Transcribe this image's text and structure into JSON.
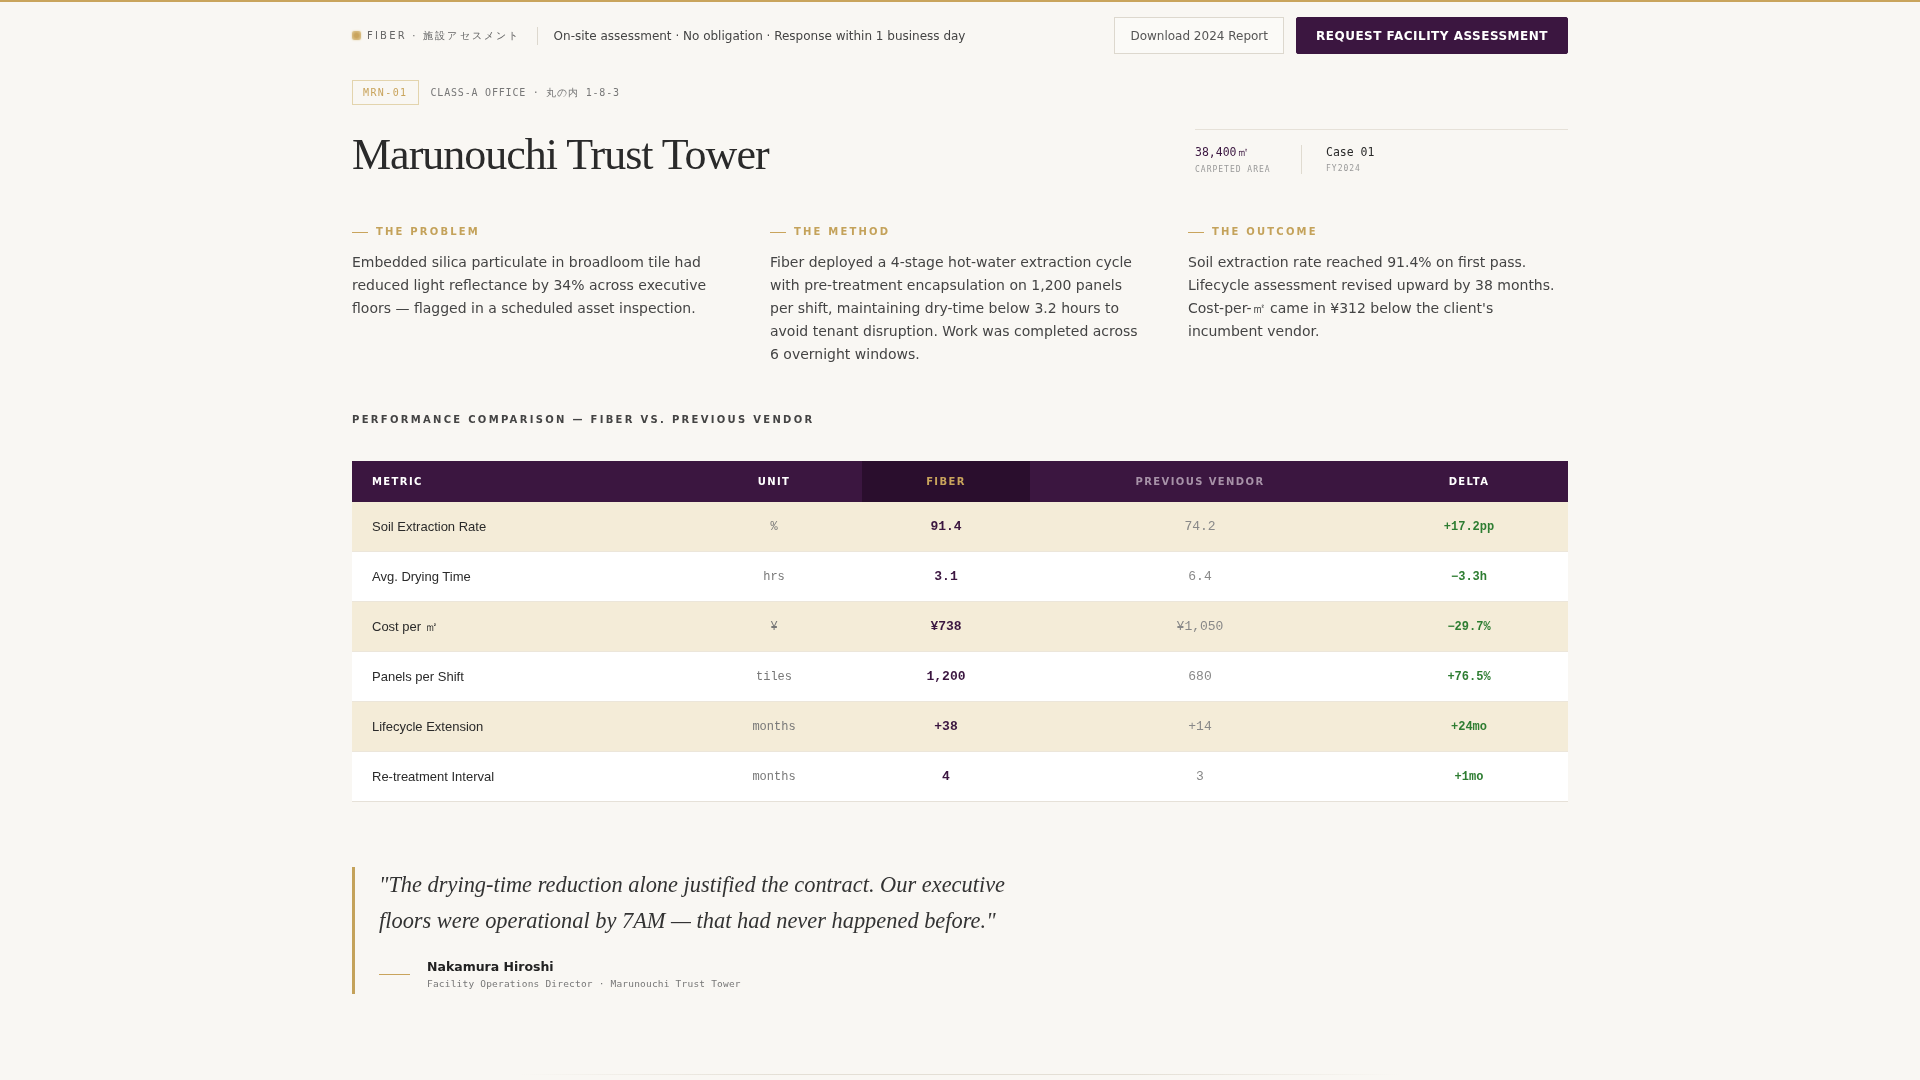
{
  "header": {
    "brand": "FIBER · 施設アセスメント",
    "tagline": "On-site assessment · No obligation · Response within 1 business day",
    "buttons": [
      {
        "label": "Download 2024 Report",
        "kind": "secondary"
      },
      {
        "label": "REQUEST FACILITY ASSESSMENT",
        "kind": "primary"
      }
    ]
  },
  "property": {
    "tag": "MRN-01",
    "meta": "CLASS-A OFFICE · 丸の内 1-8-3",
    "title": "Marunouchi Trust Tower",
    "stats": [
      {
        "value": "38,400㎡",
        "label": "CARPETED AREA",
        "kind": "accent"
      },
      {
        "value": "Case 01",
        "label": "FY2024",
        "kind": "plain"
      }
    ]
  },
  "sections": [
    {
      "label": "THE PROBLEM",
      "text": "Embedded silica particulate in broadloom tile had reduced light reflectance by 34% across executive floors — flagged in a scheduled asset inspection."
    },
    {
      "label": "THE METHOD",
      "text": "Fiber deployed a 4-stage hot-water extraction cycle with pre-treatment encapsulation on 1,200 panels per shift, maintaining dry-time below 3.2 hours to avoid tenant disruption. Work was completed across 6 overnight windows."
    },
    {
      "label": "THE OUTCOME",
      "text": "Soil extraction rate reached 91.4% on first pass. Lifecycle assessment revised upward by 38 months. Cost-per-㎡ came in ¥312 below the client's incumbent vendor."
    }
  ],
  "comparison": {
    "title": "PERFORMANCE COMPARISON — FIBER VS. PREVIOUS VENDOR",
    "columns": [
      {
        "label": "METRIC",
        "kind": "metric"
      },
      {
        "label": "UNIT",
        "kind": "unit"
      },
      {
        "label": "FIBER",
        "kind": "primary"
      },
      {
        "label": "PREVIOUS VENDOR",
        "kind": "baseline"
      },
      {
        "label": "DELTA",
        "kind": "delta"
      }
    ],
    "rows": [
      {
        "cells": [
          "Soil Extraction Rate",
          "%",
          "91.4",
          "74.2",
          "+17.2pp"
        ]
      },
      {
        "cells": [
          "Avg. Drying Time",
          "hrs",
          "3.1",
          "6.4",
          "−3.3h"
        ]
      },
      {
        "cells": [
          "Cost per ㎡",
          "¥",
          "¥738",
          "¥1,050",
          "−29.7%"
        ]
      },
      {
        "cells": [
          "Panels per Shift",
          "tiles",
          "1,200",
          "680",
          "+76.5%"
        ]
      },
      {
        "cells": [
          "Lifecycle Extension",
          "months",
          "+38",
          "+14",
          "+24mo"
        ]
      },
      {
        "cells": [
          "Re-treatment Interval",
          "months",
          "4",
          "3",
          "+1mo"
        ]
      }
    ]
  },
  "testimonial": {
    "quote": "\"The drying-time reduction alone justified the contract. Our executive floors were operational by 7AM — that had never happened before.\"",
    "name": "Nakamura Hiroshi",
    "role": "Facility Operations Director · Marunouchi Trust Tower"
  }
}
